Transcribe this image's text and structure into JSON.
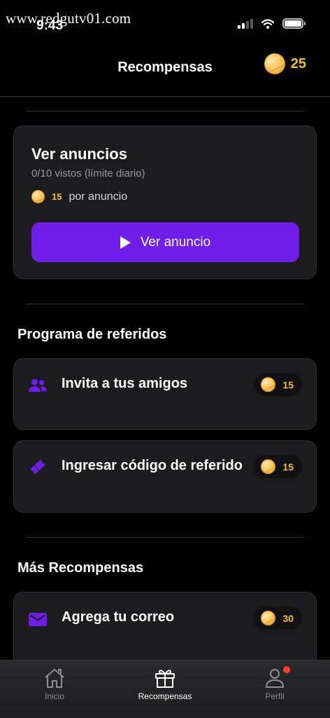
{
  "watermark": "www.redgutv01.com",
  "status_bar": {
    "time": "9:43"
  },
  "header": {
    "title": "Recompensas",
    "coins": "25"
  },
  "ads_card": {
    "title": "Ver anuncios",
    "subtitle": "0/10 vistos (límite diario)",
    "reward_amount": "15",
    "reward_suffix": "por anuncio",
    "button_label": "Ver anuncio"
  },
  "referrals": {
    "title": "Programa de referidos",
    "items": [
      {
        "label": "Invita a tus amigos",
        "reward": "15",
        "icon": "users-icon"
      },
      {
        "label": "Ingresar código de referido",
        "reward": "15",
        "icon": "ticket-icon"
      }
    ]
  },
  "more_rewards": {
    "title": "Más Recompensas",
    "items": [
      {
        "label": "Agrega tu correo",
        "reward": "30",
        "icon": "mail-icon"
      }
    ]
  },
  "tabbar": {
    "tabs": [
      {
        "label": "Inicio",
        "icon": "home-icon"
      },
      {
        "label": "Recompensas",
        "icon": "gift-icon",
        "active": true
      },
      {
        "label": "Perfil",
        "icon": "user-icon"
      }
    ]
  },
  "colors": {
    "accent": "#6f1de8",
    "coin_text": "#f5c21b",
    "card_bg": "#1c1c1e",
    "notification": "#ff3b30"
  }
}
